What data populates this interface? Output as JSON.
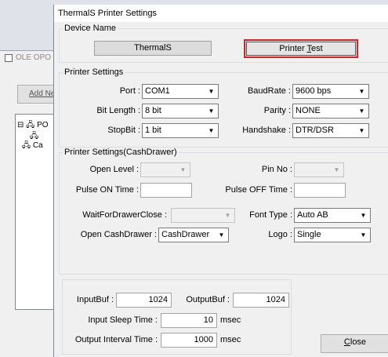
{
  "background": {
    "window_title": "OLE OPO",
    "add_button": "Add Ne",
    "tree": [
      {
        "label": "PO"
      },
      {
        "label": ""
      },
      {
        "label": "Ca"
      }
    ]
  },
  "dialog": {
    "title": "ThermalS Printer Settings",
    "device": {
      "legend": "Device Name",
      "value": "ThermalS",
      "test_pre": "Printer ",
      "test_key": "T",
      "test_post": "est"
    },
    "printer": {
      "legend": "Printer Settings",
      "port_label": "Port :",
      "port_value": "COM1",
      "baud_label": "BaudRate :",
      "baud_value": "9600 bps",
      "bitlen_label": "Bit Length :",
      "bitlen_value": "8 bit",
      "parity_label": "Parity :",
      "parity_value": "NONE",
      "stopbit_label": "StopBit :",
      "stopbit_value": "1 bit",
      "handshake_label": "Handshake :",
      "handshake_value": "DTR/DSR"
    },
    "drawer": {
      "legend": "Printer Settings(CashDrawer)",
      "open_level_label": "Open Level :",
      "open_level_value": "",
      "pin_no_label": "Pin No :",
      "pin_no_value": "",
      "pulse_on_label": "Pulse ON Time :",
      "pulse_on_value": "",
      "pulse_off_label": "Pulse OFF Time :",
      "pulse_off_value": "",
      "wait_label": "WaitForDrawerClose :",
      "wait_value": "",
      "font_label": "Font Type :",
      "font_value": "Auto AB",
      "open_drawer_label": "Open CashDrawer :",
      "open_drawer_value": "CashDrawer",
      "logo_label": "Logo :",
      "logo_value": "Single"
    },
    "buffers": {
      "input_label": "InputBuf :",
      "input_value": "1024",
      "output_label": "OutputBuf :",
      "output_value": "1024",
      "sleep_label": "Input Sleep Time :",
      "sleep_value": "10",
      "sleep_unit": "msec",
      "interval_label": "Output Interval Time :",
      "interval_value": "1000",
      "interval_unit": "msec"
    },
    "close_key": "C",
    "close_rest": "lose"
  }
}
